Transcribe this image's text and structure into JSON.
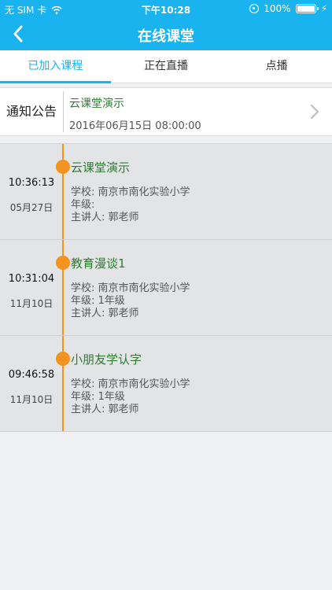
{
  "status_bar": {
    "carrier": "无 SIM 卡",
    "time": "下午10:28",
    "battery": "100%",
    "battery_level": 1.0
  },
  "nav": {
    "title": "在线课堂"
  },
  "tabs": [
    {
      "label": "已加入课程",
      "active": true
    },
    {
      "label": "正在直播",
      "active": false
    },
    {
      "label": "点播",
      "active": false
    }
  ],
  "notice": {
    "label": "通知公告",
    "title": "云课堂演示",
    "time": "2016年06月15日 08:00:00"
  },
  "courses": [
    {
      "time": "10:36:13",
      "date": "05月27日",
      "title": "云课堂演示",
      "school": "学校: 南京市南化实验小学",
      "grade": "年级:",
      "speaker": "主讲人: 郭老师"
    },
    {
      "time": "10:31:04",
      "date": "11月10日",
      "title": "教育漫谈1",
      "school": "学校: 南京市南化实验小学",
      "grade": "年级: 1年级",
      "speaker": "主讲人: 郭老师"
    },
    {
      "time": "09:46:58",
      "date": "11月10日",
      "title": "小朋友学认字",
      "school": "学校: 南京市南化实验小学",
      "grade": "年级: 1年级",
      "speaker": "主讲人: 郭老师"
    }
  ],
  "colors": {
    "accent": "#19b3ef",
    "timeline": "#f39321",
    "course_title": "#2e7d32"
  }
}
